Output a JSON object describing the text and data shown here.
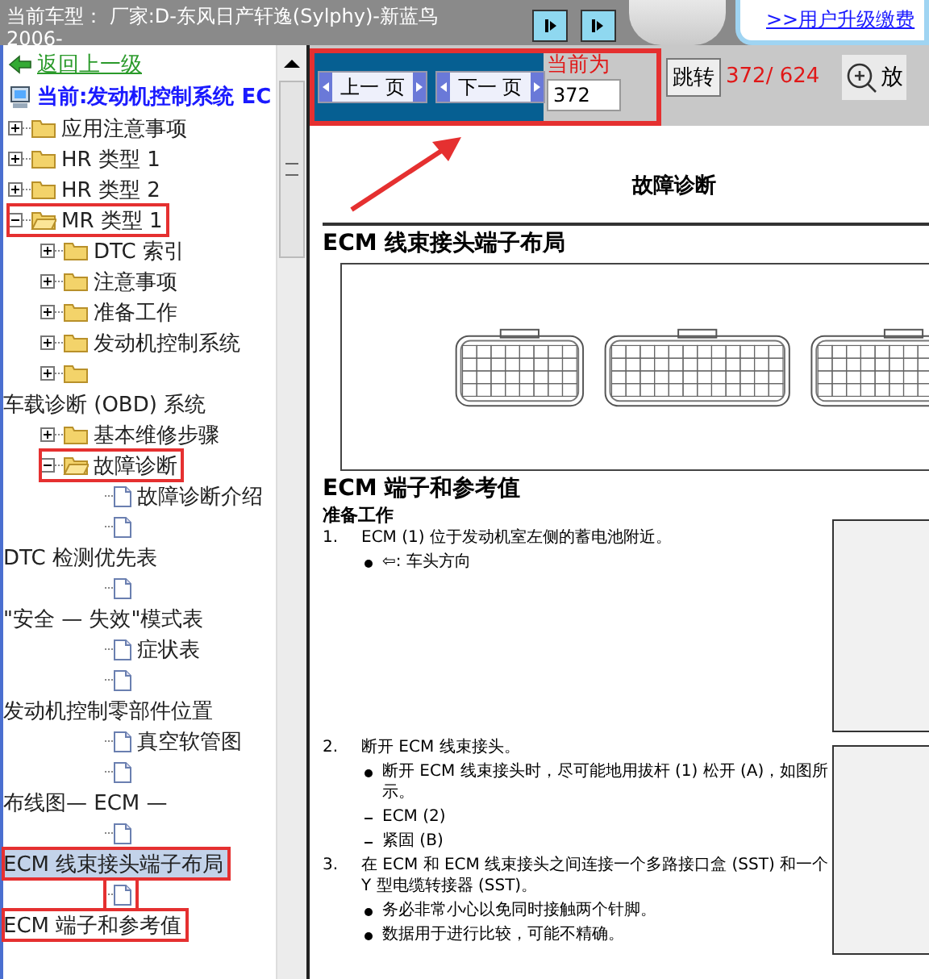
{
  "header": {
    "vehicle": "当前车型： 厂家:D-东风日产轩逸(Sylphy)-新蓝鸟",
    "vehicle_line2": "2006-",
    "upgrade_link": ">>用户升级缴费"
  },
  "sidebar": {
    "back_link": "返回上一级",
    "current": "当前:发动机控制系统 EC",
    "tree": [
      {
        "kind": "folder",
        "label": "应用注意事项",
        "expanded": false,
        "selected": false,
        "annotated": false
      },
      {
        "kind": "folder",
        "label": "HR 类型 1",
        "expanded": false,
        "selected": false,
        "annotated": false
      },
      {
        "kind": "folder",
        "label": "HR 类型 2",
        "expanded": false,
        "selected": false,
        "annotated": false
      },
      {
        "kind": "folder",
        "label": "MR 类型 1",
        "expanded": true,
        "selected": false,
        "annotated": true,
        "children": [
          {
            "kind": "folder",
            "label": "DTC 索引",
            "expanded": false,
            "selected": false,
            "annotated": false
          },
          {
            "kind": "folder",
            "label": "注意事项",
            "expanded": false,
            "selected": false,
            "annotated": false
          },
          {
            "kind": "folder",
            "label": "准备工作",
            "expanded": false,
            "selected": false,
            "annotated": false
          },
          {
            "kind": "folder",
            "label": "发动机控制系统",
            "expanded": false,
            "selected": false,
            "annotated": false
          },
          {
            "kind": "folder",
            "expanded": false,
            "selected": false,
            "annotated": false
          },
          {
            "kind": "caption",
            "label": "车载诊断 (OBD) 系统",
            "selected": false,
            "annotated": false
          },
          {
            "kind": "folder",
            "label": "基本维修步骤",
            "expanded": false,
            "selected": false,
            "annotated": false
          },
          {
            "kind": "folder",
            "label": "故障诊断",
            "expanded": true,
            "selected": false,
            "annotated": true,
            "children": [
              {
                "kind": "page",
                "label": "故障诊断介绍",
                "selected": false,
                "annotated": false
              },
              {
                "kind": "page",
                "selected": false,
                "annotated": false
              },
              {
                "kind": "caption",
                "label": "DTC 检测优先表",
                "selected": false,
                "annotated": false
              },
              {
                "kind": "page",
                "selected": false,
                "annotated": false
              },
              {
                "kind": "caption",
                "label": "\"安全 — 失效\"模式表",
                "selected": false,
                "annotated": false
              },
              {
                "kind": "page",
                "label": "症状表",
                "selected": false,
                "annotated": false
              },
              {
                "kind": "page",
                "selected": false,
                "annotated": false
              },
              {
                "kind": "caption",
                "label": "发动机控制零部件位置",
                "selected": false,
                "annotated": false
              },
              {
                "kind": "page",
                "label": "真空软管图",
                "selected": false,
                "annotated": false
              },
              {
                "kind": "page",
                "selected": false,
                "annotated": false
              },
              {
                "kind": "caption",
                "label": "布线图— ECM —",
                "selected": false,
                "annotated": false
              },
              {
                "kind": "page",
                "selected": false,
                "annotated": false
              },
              {
                "kind": "caption",
                "label": "ECM 线束接头端子布局",
                "selected": true,
                "annotated": true
              },
              {
                "kind": "page",
                "selected": false,
                "annotated": true
              },
              {
                "kind": "caption",
                "label": "ECM 端子和参考值",
                "selected": false,
                "annotated": true
              }
            ]
          }
        ]
      }
    ]
  },
  "toolbar": {
    "annotated": true,
    "prev": "上一 页",
    "next": "下一 页",
    "current_label": "当前为",
    "page_input": "372",
    "jump": "跳转",
    "page_count": "372/ 624",
    "zoom": "放"
  },
  "document": {
    "title": "故障诊断",
    "section1": "ECM 线束接头端子布局",
    "section2": "ECM 端子和参考值",
    "subsection": "准备工作",
    "steps": [
      {
        "kind": "step",
        "num": "1.",
        "text": "ECM (1) 位于发动机室左侧的蓄电池附近。"
      },
      {
        "kind": "bullet",
        "text": "⇦: 车头方向"
      },
      {
        "kind": "gap"
      },
      {
        "kind": "step",
        "num": "2.",
        "text": "断开 ECM 线束接头。"
      },
      {
        "kind": "bullet",
        "text": "断开 ECM 线束接头时，尽可能地用拔杆 (1) 松开 (A)，如图所示。"
      },
      {
        "kind": "dash",
        "text": "ECM (2)"
      },
      {
        "kind": "dash",
        "text": "紧固 (B)"
      },
      {
        "kind": "step",
        "num": "3.",
        "text": "在 ECM 和 ECM 线束接头之间连接一个多路接口盒 (SST) 和一个 Y 型电缆转接器 (SST)。"
      },
      {
        "kind": "bullet",
        "text": "务必非常小心以免同时接触两个针脚。"
      },
      {
        "kind": "bullet",
        "text": "数据用于进行比较，可能不精确。"
      }
    ]
  }
}
